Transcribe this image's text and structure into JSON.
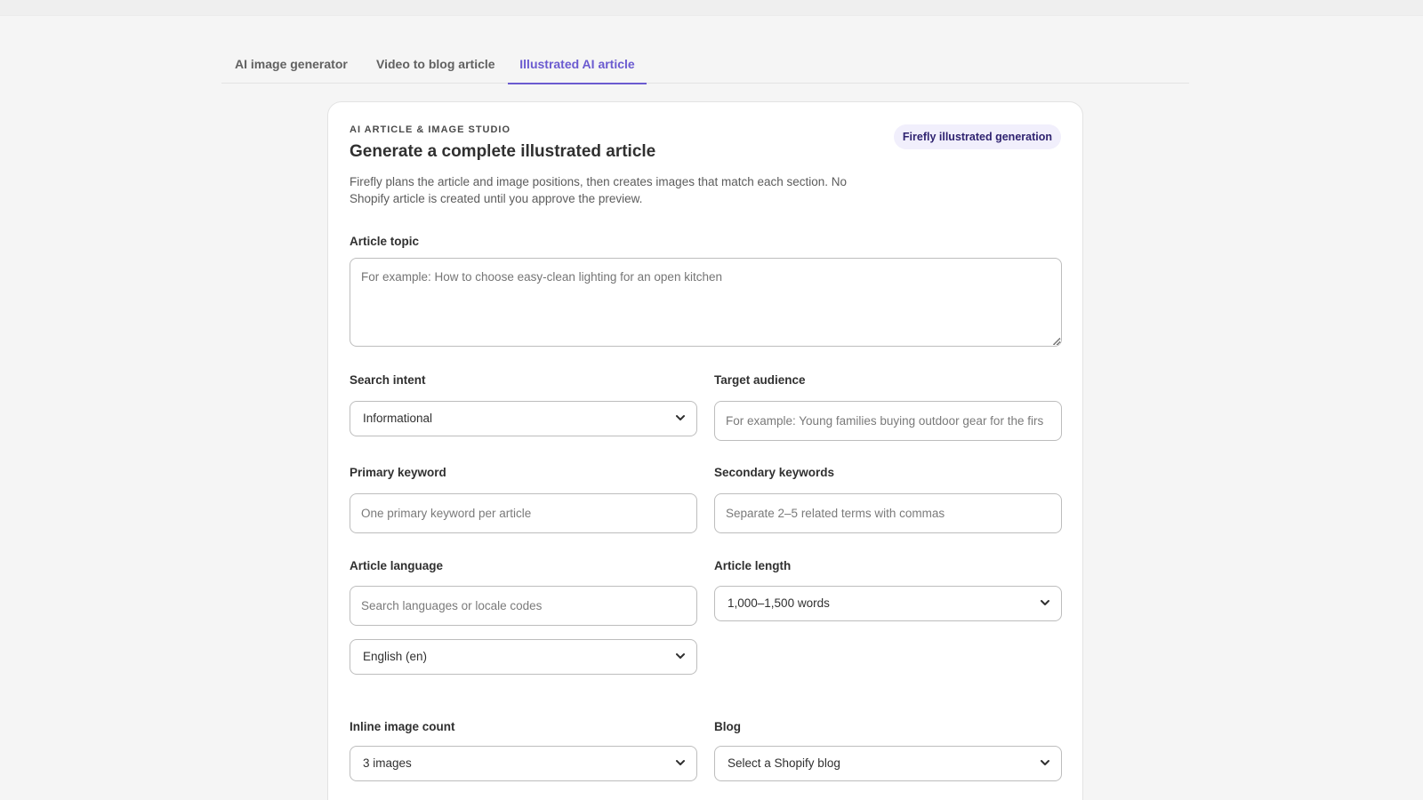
{
  "tabs": [
    {
      "label": "AI image generator"
    },
    {
      "label": "Video to blog article"
    },
    {
      "label": "Illustrated AI article"
    }
  ],
  "active_tab": "Illustrated AI article",
  "card": {
    "eyebrow": "AI ARTICLE & IMAGE STUDIO",
    "title": "Generate a complete illustrated article",
    "description": "Firefly plans the article and image positions, then creates images that match each section. No Shopify article is created until you approve the preview.",
    "badge": "Firefly illustrated generation"
  },
  "form": {
    "topic": {
      "label": "Article topic",
      "placeholder": "For example: How to choose easy-clean lighting for an open kitchen"
    },
    "search_intent": {
      "label": "Search intent",
      "value": "Informational"
    },
    "target_audience": {
      "label": "Target audience",
      "placeholder": "For example: Young families buying outdoor gear for the firs"
    },
    "primary_keyword": {
      "label": "Primary keyword",
      "placeholder": "One primary keyword per article"
    },
    "secondary_keywords": {
      "label": "Secondary keywords",
      "placeholder": "Separate 2–5 related terms with commas"
    },
    "article_language": {
      "label": "Article language",
      "placeholder": "Search languages or locale codes",
      "value": "English (en)"
    },
    "article_length": {
      "label": "Article length",
      "value": "1,000–1,500 words"
    },
    "inline_image_count": {
      "label": "Inline image count",
      "value": "3 images"
    },
    "blog": {
      "label": "Blog",
      "value": "Select a Shopify blog"
    }
  },
  "colors": {
    "accent": "#6b5bd0",
    "badge_bg": "#f1effc",
    "badge_text": "#2f2370",
    "page_bg": "#f5f5f5"
  }
}
